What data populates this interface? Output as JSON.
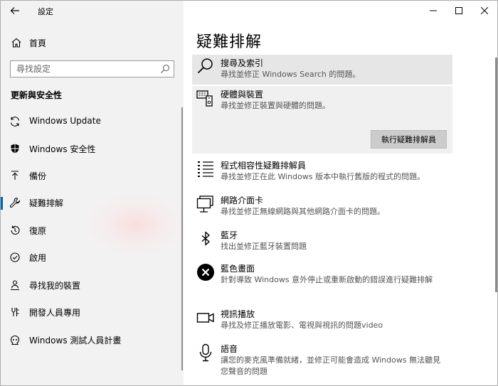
{
  "window": {
    "title": "設定"
  },
  "sidebar": {
    "home_label": "首頁",
    "search_placeholder": "尋找設定",
    "section_heading": "更新與安全性",
    "items": [
      {
        "label": "Windows Update",
        "icon": "refresh-icon"
      },
      {
        "label": "Windows 安全性",
        "icon": "shield-icon"
      },
      {
        "label": "備份",
        "icon": "backup-arrow-icon"
      },
      {
        "label": "疑難排解",
        "icon": "wrench-icon",
        "selected": true
      },
      {
        "label": "復原",
        "icon": "recovery-icon"
      },
      {
        "label": "啟用",
        "icon": "activation-icon"
      },
      {
        "label": "尋找我的裝置",
        "icon": "person-location-icon"
      },
      {
        "label": "開發人員專用",
        "icon": "developer-icon"
      },
      {
        "label": "Windows 測試人員計畫",
        "icon": "insider-icon"
      }
    ]
  },
  "main": {
    "page_title": "疑難排解",
    "run_button": "執行疑難排解員",
    "items": [
      {
        "name": "搜尋及索引",
        "desc": "尋找並修正 Windows Search 的問題。",
        "icon": "search-icon"
      },
      {
        "name": "硬體與裝置",
        "desc": "尋找並修正裝置與硬體的問題。",
        "icon": "hardware-icon"
      },
      {
        "name": "程式相容性疑難排解員",
        "desc": "尋找並修正在此 Windows 版本中執行舊版的程式的問題。",
        "icon": "list-icon"
      },
      {
        "name": "網路介面卡",
        "desc": "尋找並修正無線網路與其他網路介面卡的問題。",
        "icon": "network-adapter-icon"
      },
      {
        "name": "藍牙",
        "desc": "找出並修正藍牙裝置問題",
        "icon": "bluetooth-icon"
      },
      {
        "name": "藍色畫面",
        "desc": "針對導致 Windows 意外停止或重新啟動的錯誤進行疑難排解",
        "icon": "error-x-icon"
      },
      {
        "name": "視訊播放",
        "desc": "尋找及修正播放電影、電視與視訊的問題video",
        "icon": "video-camera-icon"
      },
      {
        "name": "語音",
        "desc": "讓您的麥克風準備就緒，並修正可能會造成 Windows 無法聽見您聲音的問題",
        "icon": "microphone-icon"
      }
    ]
  }
}
